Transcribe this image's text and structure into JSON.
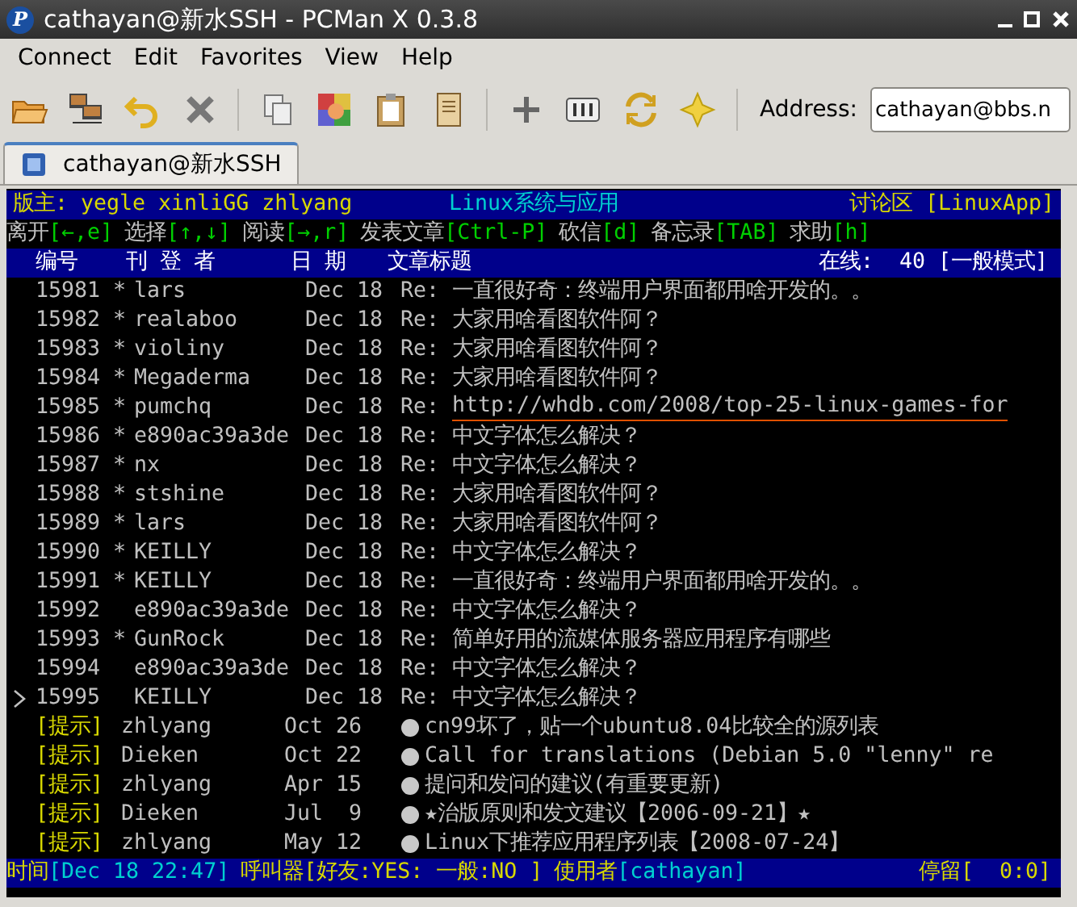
{
  "window": {
    "logo": "P",
    "title": "cathayan@新水SSH - PCMan X 0.3.8"
  },
  "menu": [
    {
      "label": "Connect"
    },
    {
      "label": "Edit"
    },
    {
      "label": "Favorites"
    },
    {
      "label": "View"
    },
    {
      "label": "Help"
    }
  ],
  "toolbar": {
    "address_label": "Address:",
    "address_value": "cathayan@bbs.n"
  },
  "tabs": [
    {
      "label": "cathayan@新水SSH",
      "selected": true
    }
  ],
  "terminal": {
    "board_header": {
      "moderators": "版主: yegle xinliGG zhlyang",
      "board_title_latin": "Linux",
      "board_title": "系统与应用",
      "zone": "讨论区 [LinuxApp]"
    },
    "help_line": [
      {
        "label": "离开",
        "key": "[←,e]"
      },
      {
        "label": "选择",
        "key": "[↑,↓]"
      },
      {
        "label": "阅读",
        "key": "[→,r]"
      },
      {
        "label": "发表文章",
        "key": "[Ctrl-P]"
      },
      {
        "label": "砍信",
        "key": "[d]"
      },
      {
        "label": "备忘录",
        "key": "[TAB]"
      },
      {
        "label": "求助",
        "key": "[h]"
      }
    ],
    "columns": {
      "number": "编号",
      "author": "刊 登 者",
      "date": "日 期",
      "title": "文章标题",
      "online_label": "在线:",
      "online_count": "40",
      "mode": "[一般模式]"
    },
    "rows": [
      {
        "number": "15981",
        "flag": "*",
        "author": "lars",
        "date": "Dec 18",
        "prefix": "Re:",
        "title": "一直很好奇：终端用户界面都用啥开发的。。",
        "link": false,
        "selected": false
      },
      {
        "number": "15982",
        "flag": "*",
        "author": "realaboo",
        "date": "Dec 18",
        "prefix": "Re:",
        "title": "大家用啥看图软件阿？",
        "link": false,
        "selected": false
      },
      {
        "number": "15983",
        "flag": "*",
        "author": "violiny",
        "date": "Dec 18",
        "prefix": "Re:",
        "title": "大家用啥看图软件阿？",
        "link": false,
        "selected": false
      },
      {
        "number": "15984",
        "flag": "*",
        "author": "Megaderma",
        "date": "Dec 18",
        "prefix": "Re:",
        "title": "大家用啥看图软件阿？",
        "link": false,
        "selected": false
      },
      {
        "number": "15985",
        "flag": "*",
        "author": "pumchq",
        "date": "Dec 18",
        "prefix": "Re:",
        "title": "http://whdb.com/2008/top-25-linux-games-for",
        "link": true,
        "selected": false
      },
      {
        "number": "15986",
        "flag": "*",
        "author": "e890ac39a3de",
        "date": "Dec 18",
        "prefix": "Re:",
        "title": "中文字体怎么解决？",
        "link": false,
        "selected": false
      },
      {
        "number": "15987",
        "flag": "*",
        "author": "nx",
        "date": "Dec 18",
        "prefix": "Re:",
        "title": "中文字体怎么解决？",
        "link": false,
        "selected": false
      },
      {
        "number": "15988",
        "flag": "*",
        "author": "stshine",
        "date": "Dec 18",
        "prefix": "Re:",
        "title": "大家用啥看图软件阿？",
        "link": false,
        "selected": false
      },
      {
        "number": "15989",
        "flag": "*",
        "author": "lars",
        "date": "Dec 18",
        "prefix": "Re:",
        "title": "大家用啥看图软件阿？",
        "link": false,
        "selected": false
      },
      {
        "number": "15990",
        "flag": "*",
        "author": "KEILLY",
        "date": "Dec 18",
        "prefix": "Re:",
        "title": "中文字体怎么解决？",
        "link": false,
        "selected": false
      },
      {
        "number": "15991",
        "flag": "*",
        "author": "KEILLY",
        "date": "Dec 18",
        "prefix": "Re:",
        "title": "一直很好奇：终端用户界面都用啥开发的。。",
        "link": false,
        "selected": false
      },
      {
        "number": "15992",
        "author": "e890ac39a3de",
        "date": "Dec 18",
        "prefix": "Re:",
        "title": "中文字体怎么解决？",
        "link": false,
        "selected": false
      },
      {
        "number": "15993",
        "flag": "*",
        "author": "GunRock",
        "date": "Dec 18",
        "prefix": "Re:",
        "title": "简单好用的流媒体服务器应用程序有哪些",
        "link": false,
        "selected": false
      },
      {
        "number": "15994",
        "author": "e890ac39a3de",
        "date": "Dec 18",
        "prefix": "Re:",
        "title": "中文字体怎么解决？",
        "link": false,
        "selected": false
      },
      {
        "number": "15995",
        "author": "KEILLY",
        "date": "Dec 18",
        "prefix": "Re:",
        "title": "中文字体怎么解决？",
        "link": false,
        "selected": true
      }
    ],
    "notices": [
      {
        "tag": "[提示]",
        "author": "zhlyang",
        "date": "Oct 26",
        "title": "cn99坏了，贴一个ubuntu8.04比较全的源列表"
      },
      {
        "tag": "[提示]",
        "author": "Dieken",
        "date": "Oct 22",
        "title": "Call for translations (Debian 5.0 \"lenny\" re"
      },
      {
        "tag": "[提示]",
        "author": "zhlyang",
        "date": "Apr 15",
        "title": "提问和发问的建议(有重要更新)"
      },
      {
        "tag": "[提示]",
        "author": "Dieken",
        "date": "Jul  9",
        "title": "★治版原则和发文建议【2006-09-21】★"
      },
      {
        "tag": "[提示]",
        "author": "zhlyang",
        "date": "May 12",
        "title": "Linux下推荐应用程序列表【2008-07-24】"
      }
    ],
    "status_line": [
      {
        "kind": "label",
        "text": "时间"
      },
      {
        "kind": "value",
        "text": "[Dec 18 22:47]"
      },
      {
        "kind": "label",
        "text": "呼叫器[好友:YES: 一般:NO ]"
      },
      {
        "kind": "label",
        "text": "使用者"
      },
      {
        "kind": "value",
        "text": "[cathayan]"
      },
      {
        "kind": "spacer"
      },
      {
        "kind": "label",
        "text": "停留[  0:0]"
      }
    ]
  }
}
